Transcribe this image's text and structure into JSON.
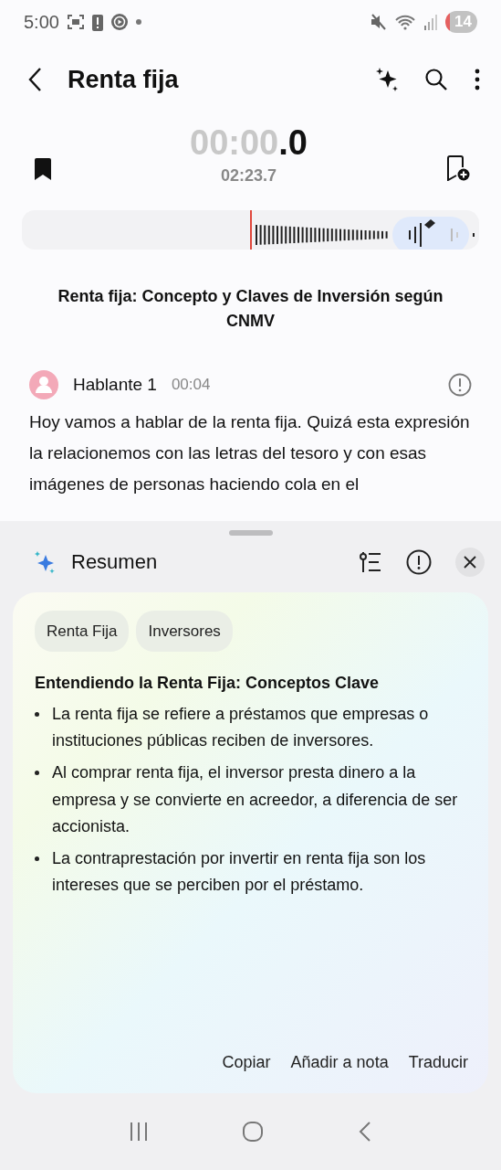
{
  "status_bar": {
    "time": "5:00",
    "battery": "14"
  },
  "app_bar": {
    "title": "Renta fija"
  },
  "player": {
    "time": "00:00.0",
    "duration": "02:23.7"
  },
  "recording_title": "Renta fija: Concepto y Claves de Inversión según CNMV",
  "transcript": {
    "speaker": "Hablante 1",
    "timestamp": "00:04",
    "text": "Hoy vamos a hablar de la renta fija. Quizá esta expresión la relacionemos con las letras del tesoro y con esas imágenes de personas haciendo cola en el"
  },
  "summary": {
    "title": "Resumen",
    "tags": [
      "Renta Fija",
      "Inversores"
    ],
    "heading": "Entendiendo la Renta Fija: Conceptos Clave",
    "bullets": [
      "La renta fija se refiere a préstamos que empresas o instituciones públicas reciben de inversores.",
      "Al comprar renta fija, el inversor presta dinero a la empresa y se convierte en acreedor, a diferencia de ser accionista.",
      "La contraprestación por invertir en renta fija son los intereses que se perciben por el préstamo."
    ],
    "actions": [
      "Copiar",
      "Añadir a nota",
      "Traducir"
    ]
  }
}
